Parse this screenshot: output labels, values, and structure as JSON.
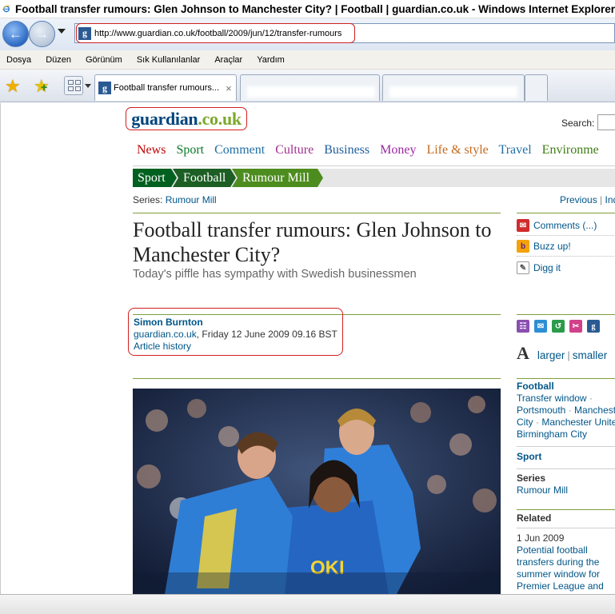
{
  "window": {
    "title": "Football transfer rumours: Glen Johnson to Manchester City? | Football | guardian.co.uk - Windows Internet Explorer"
  },
  "browser": {
    "url": "http://www.guardian.co.uk/football/2009/jun/12/transfer-rumours",
    "menu": [
      "Dosya",
      "Düzen",
      "Görünüm",
      "Sık Kullanılanlar",
      "Araçlar",
      "Yardım"
    ],
    "active_tab": "Football transfer rumours...",
    "tab_close": "×"
  },
  "site": {
    "logo_main": "guardian",
    "logo_suffix": ".co.uk",
    "search_label": "Search:"
  },
  "nav": [
    {
      "label": "News",
      "color": "#c00000"
    },
    {
      "label": "Sport",
      "color": "#0a7a2b"
    },
    {
      "label": "Comment",
      "color": "#1f6fa6"
    },
    {
      "label": "Culture",
      "color": "#a0308e"
    },
    {
      "label": "Business",
      "color": "#1f5e9c"
    },
    {
      "label": "Money",
      "color": "#9a2aa0"
    },
    {
      "label": "Life & style",
      "color": "#c46a1e"
    },
    {
      "label": "Travel",
      "color": "#1f6fa6"
    },
    {
      "label": "Environme",
      "color": "#3f7d14"
    }
  ],
  "breadcrumb": [
    "Sport",
    "Football",
    "Rumour Mill"
  ],
  "series": {
    "prefix": "Series:",
    "name": "Rumour Mill",
    "previous": "Previous",
    "separator": "|",
    "next": "Ind"
  },
  "article": {
    "headline": "Football transfer rumours: Glen Johnson to Manchester City?",
    "standfirst": "Today's piffle has sympathy with Swedish businessmen",
    "author": "Simon Burnton",
    "source": "guardian.co.uk",
    "date": ", Friday 12 June 2009 09.16 BST",
    "history": "Article history",
    "photo_kit_text": "OKI"
  },
  "tools": {
    "comments": "Comments (...)",
    "buzz": "Buzz up!",
    "digg": "Digg it",
    "text_a": "A",
    "larger": "larger",
    "bar": "|",
    "smaller": "smaller"
  },
  "sidebar": {
    "football_head": "Football",
    "football_l1a": "Transfer window",
    "football_dot": "·",
    "football_l2a": "Portsmouth",
    "football_l2b": "Manchest",
    "football_l3a": "City",
    "football_l3b": "Manchester United",
    "football_l4": "Birmingham City",
    "sport_head": "Sport",
    "series_head": "Series",
    "series_name": "Rumour Mill",
    "related_head": "Related",
    "related_date": "1 Jun 2009",
    "related_text": "Potential football transfers during the summer window for Premier League and"
  },
  "colors": {
    "link_blue": "#005689",
    "guardian_navy": "#00457c",
    "guardian_green": "#7da82b",
    "annotation_red": "#d21f1f"
  }
}
